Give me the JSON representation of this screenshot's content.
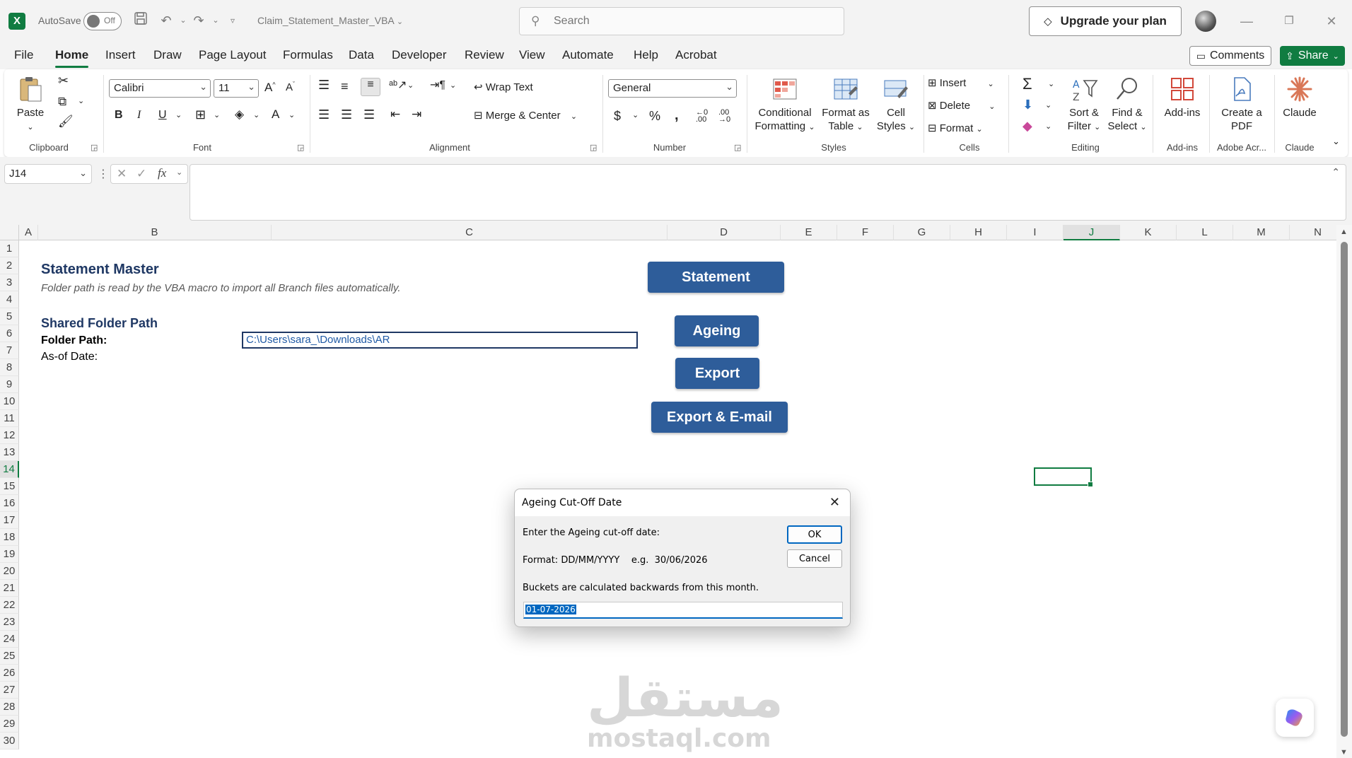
{
  "titlebar": {
    "autosave_label": "AutoSave",
    "autosave_state": "Off",
    "doc_title": "Claim_Statement_Master_VBA",
    "search_placeholder": "Search",
    "upgrade_label": "Upgrade your plan"
  },
  "menu": {
    "tabs": [
      "File",
      "Home",
      "Insert",
      "Draw",
      "Page Layout",
      "Formulas",
      "Data",
      "Developer",
      "Review",
      "View",
      "Automate",
      "Help",
      "Acrobat"
    ],
    "active_tab": "Home",
    "comments_label": "Comments",
    "share_label": "Share"
  },
  "ribbon": {
    "clipboard": {
      "paste": "Paste",
      "label": "Clipboard"
    },
    "font": {
      "name": "Calibri",
      "size": "11",
      "label": "Font"
    },
    "alignment": {
      "wrap_text": "Wrap Text",
      "merge_center": "Merge & Center",
      "label": "Alignment"
    },
    "number": {
      "format": "General",
      "label": "Number"
    },
    "styles": {
      "conditional": "Conditional Formatting",
      "format_table": "Format as Table",
      "cell_styles": "Cell Styles",
      "label": "Styles"
    },
    "cells": {
      "insert": "Insert",
      "delete": "Delete",
      "format": "Format",
      "label": "Cells"
    },
    "editing": {
      "sort_filter": "Sort & Filter",
      "find_select": "Find & Select",
      "label": "Editing"
    },
    "addins": {
      "addins": "Add-ins",
      "label": "Add-ins"
    },
    "acrobat": {
      "create_pdf": "Create a PDF",
      "label": "Adobe Acr..."
    },
    "claude": {
      "claude": "Claude",
      "label": "Claude"
    }
  },
  "formula_bar": {
    "name_box": "J14",
    "formula": ""
  },
  "grid": {
    "columns": [
      "A",
      "B",
      "C",
      "D",
      "E",
      "F",
      "G",
      "H",
      "I",
      "J",
      "K",
      "L",
      "M",
      "N"
    ],
    "rows": [
      "1",
      "2",
      "3",
      "4",
      "5",
      "6",
      "7",
      "8",
      "9",
      "10",
      "11",
      "12",
      "13",
      "14",
      "15",
      "16",
      "17",
      "18",
      "19",
      "20",
      "21",
      "22",
      "23",
      "24",
      "25",
      "26",
      "27",
      "28",
      "29",
      "30"
    ],
    "selected_column": "J",
    "selected_row": "14"
  },
  "sheet": {
    "title": "Statement Master",
    "subtitle": "Folder path is read by the VBA macro to import all Branch files automatically.",
    "section": "Shared Folder Path",
    "folder_label": "Folder Path:",
    "folder_value": "C:\\Users\\sara_\\Downloads\\AR",
    "asof_label": "As-of Date:",
    "buttons": {
      "statement": "Statement",
      "ageing": "Ageing",
      "export": "Export",
      "export_email": "Export & E-mail"
    }
  },
  "watermark": {
    "arabic": "مستقل",
    "latin": "mostaql.com"
  },
  "dialog": {
    "title": "Ageing Cut-Off Date",
    "prompt": "Enter the Ageing cut-off date:",
    "format_line": "Format: DD/MM/YYYY    e.g.  30/06/2026",
    "buckets_line": "Buckets are calculated backwards from this month.",
    "ok": "OK",
    "cancel": "Cancel",
    "input_value": "01-07-2026"
  },
  "colors": {
    "excel_green": "#107c41",
    "macro_button": "#2e5d9a",
    "title_navy": "#1f3864",
    "dialog_accent": "#0067c0"
  }
}
